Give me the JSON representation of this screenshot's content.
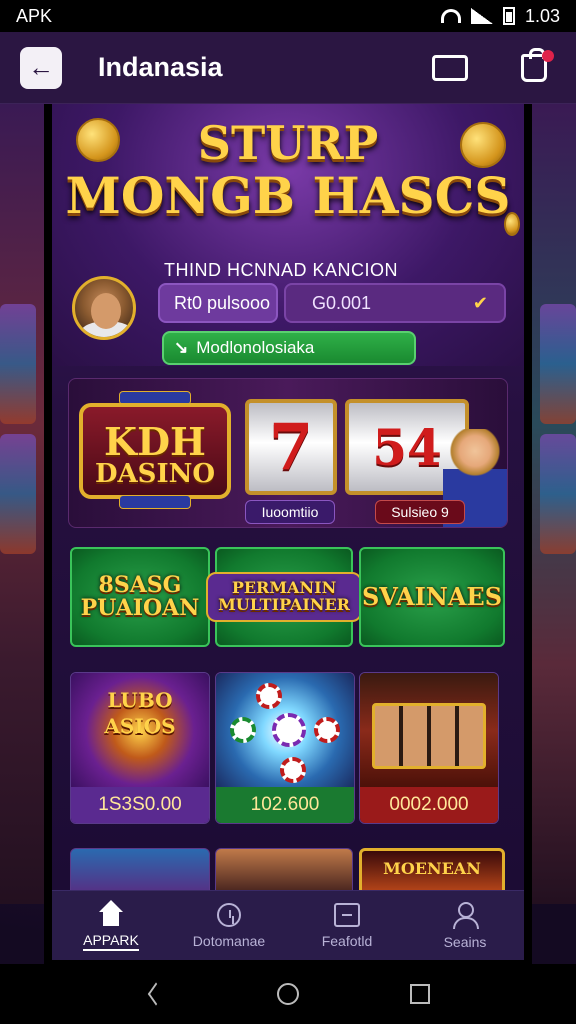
{
  "status_bar": {
    "left_text": "APK",
    "time": "1.03"
  },
  "app_bar": {
    "title": "Indanasia"
  },
  "hero": {
    "title_line1": "STURP",
    "title_line2": "MONGB HASCS",
    "subtitle": "THIND HCNNAD KANCION",
    "player_name": "Rt0 pulsooo",
    "balance": "G0.001",
    "promo": "Modlonolosiaka"
  },
  "banner": {
    "logo_line1": "KDH",
    "logo_line2": "DASINO",
    "reel1": "7",
    "reel2": "54",
    "tag_left": "Iuoomtiio",
    "tag_right": "Sulsieo 9"
  },
  "categories": [
    {
      "label": "8SASG PUAIOAN"
    },
    {
      "label": "PERMANIN MULTIPAINER"
    },
    {
      "label": "SVAINAES"
    }
  ],
  "games": [
    {
      "art_label": "LUBO ASIOS",
      "price": "1S3S0.00"
    },
    {
      "art_label": "",
      "price": "102.600"
    },
    {
      "art_label": "",
      "price": "0002.000"
    }
  ],
  "partial_games": [
    {
      "label": ""
    },
    {
      "label": ""
    },
    {
      "label": "MOENEAN"
    }
  ],
  "bottom_nav": [
    {
      "label": "APPARK",
      "icon": "home-icon",
      "active": true
    },
    {
      "label": "Dotomanae",
      "icon": "clock-icon",
      "active": false
    },
    {
      "label": "Feafotld",
      "icon": "card-icon",
      "active": false
    },
    {
      "label": "Seains",
      "icon": "user-icon",
      "active": false
    }
  ],
  "colors": {
    "accent_gold": "#ffd34a",
    "bg_purple": "#2b1642",
    "green": "#1a8a30",
    "notif": "#e0224a"
  }
}
